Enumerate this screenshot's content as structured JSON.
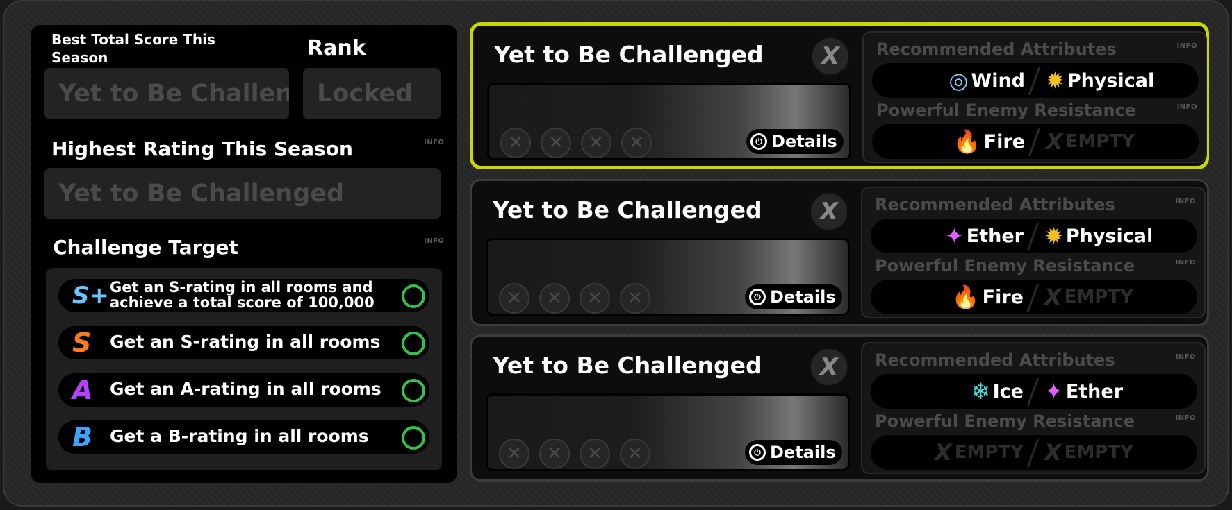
{
  "left": {
    "best_score_label": "Best Total Score This Season",
    "best_score_value": "Yet to Be Challenged",
    "rank_label": "Rank",
    "rank_value": "Locked",
    "highest_rating_label": "Highest Rating This Season",
    "highest_rating_value": "Yet to Be Challenged",
    "challenge_target_label": "Challenge Target",
    "info_label": "INFO",
    "targets": [
      {
        "rank": "S+",
        "text": "Get an S-rating in all rooms and achieve a total score of 100,000",
        "color": "#6ac4ff"
      },
      {
        "rank": "S",
        "text": "Get an S-rating in all rooms",
        "color": "#ff7a1a"
      },
      {
        "rank": "A",
        "text": "Get an A-rating in all rooms",
        "color": "#b640ff"
      },
      {
        "rank": "B",
        "text": "Get a B-rating in all rooms",
        "color": "#3aa4ff"
      }
    ]
  },
  "rooms": [
    {
      "title": "Yet to Be Challenged",
      "close": "X",
      "details": "Details",
      "recommended_label": "Recommended Attributes",
      "resistance_label": "Powerful Enemy Resistance",
      "info_label": "INFO",
      "recommended": [
        {
          "name": "Wind",
          "icon": "wind-icon",
          "glyph": "◎",
          "color": "#7fd0ff"
        },
        {
          "name": "Physical",
          "icon": "physical-icon",
          "glyph": "✹",
          "color": "#f4c020"
        }
      ],
      "resistance": [
        {
          "name": "Fire",
          "icon": "fire-icon",
          "glyph": "🔥",
          "color": "#ff5a1a"
        },
        {
          "name": "EMPTY",
          "icon": "empty-icon",
          "glyph": "X",
          "color": "#2d2d2d"
        }
      ]
    },
    {
      "title": "Yet to Be Challenged",
      "close": "X",
      "details": "Details",
      "recommended_label": "Recommended Attributes",
      "resistance_label": "Powerful Enemy Resistance",
      "info_label": "INFO",
      "recommended": [
        {
          "name": "Ether",
          "icon": "ether-icon",
          "glyph": "✦",
          "color": "#e25cff"
        },
        {
          "name": "Physical",
          "icon": "physical-icon",
          "glyph": "✹",
          "color": "#f4c020"
        }
      ],
      "resistance": [
        {
          "name": "Fire",
          "icon": "fire-icon",
          "glyph": "🔥",
          "color": "#ff5a1a"
        },
        {
          "name": "EMPTY",
          "icon": "empty-icon",
          "glyph": "X",
          "color": "#2d2d2d"
        }
      ]
    },
    {
      "title": "Yet to Be Challenged",
      "close": "X",
      "details": "Details",
      "recommended_label": "Recommended Attributes",
      "resistance_label": "Powerful Enemy Resistance",
      "info_label": "INFO",
      "recommended": [
        {
          "name": "Ice",
          "icon": "ice-icon",
          "glyph": "❄",
          "color": "#40e0e0"
        },
        {
          "name": "Ether",
          "icon": "ether-icon",
          "glyph": "✦",
          "color": "#e25cff"
        }
      ],
      "resistance": [
        {
          "name": "EMPTY",
          "icon": "empty-icon",
          "glyph": "X",
          "color": "#2d2d2d"
        },
        {
          "name": "EMPTY",
          "icon": "empty-icon",
          "glyph": "X",
          "color": "#2d2d2d"
        }
      ]
    }
  ],
  "colors": {
    "active_border": "#c9d600",
    "target_complete_ring": "#2fc34a"
  }
}
